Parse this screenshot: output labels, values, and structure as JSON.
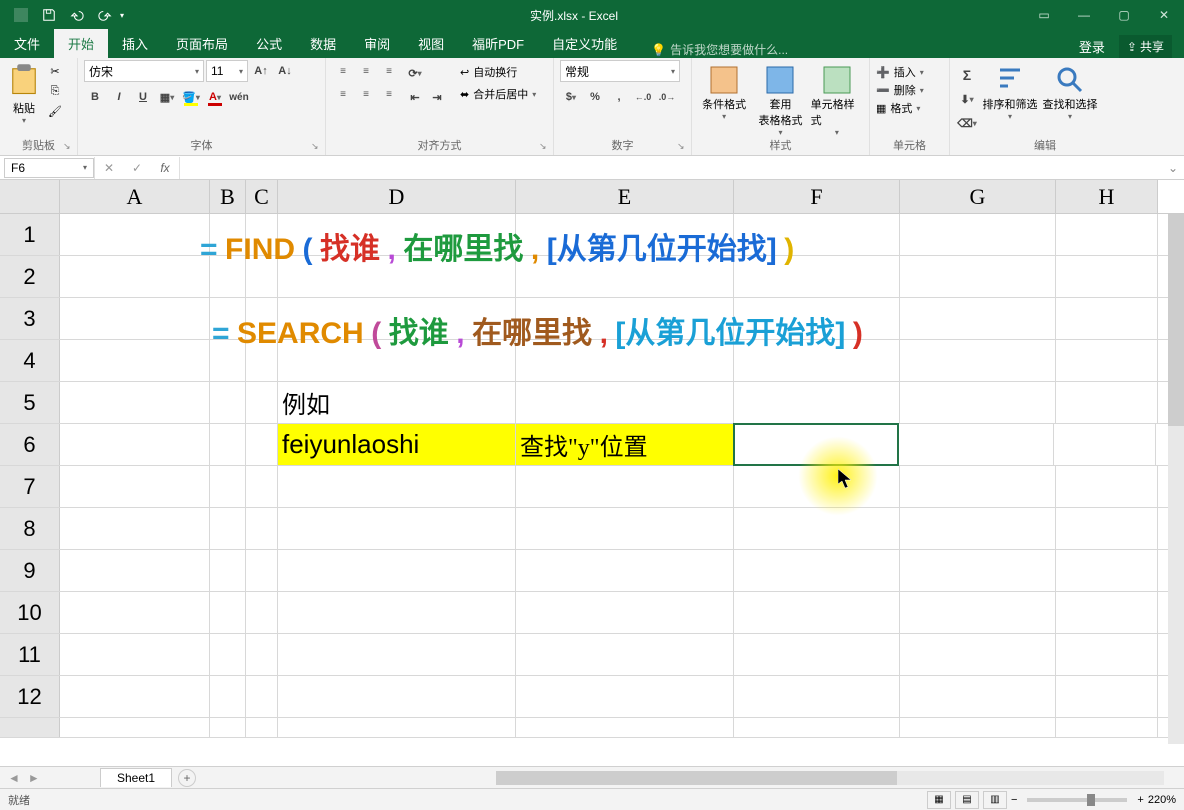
{
  "titlebar": {
    "filename": "实例.xlsx - Excel"
  },
  "tabs": {
    "items": [
      "文件",
      "开始",
      "插入",
      "页面布局",
      "公式",
      "数据",
      "审阅",
      "视图",
      "福昕PDF",
      "自定义功能"
    ],
    "active": 1,
    "tell_me": "告诉我您想要做什么...",
    "login": "登录",
    "share": "共享"
  },
  "ribbon": {
    "clipboard": {
      "label": "剪贴板",
      "paste": "粘贴"
    },
    "font": {
      "label": "字体",
      "name": "仿宋",
      "size": "11",
      "bold": "B",
      "italic": "I",
      "underline": "U",
      "ruby": "wén"
    },
    "align": {
      "label": "对齐方式",
      "wrap": "自动换行",
      "merge": "合并后居中"
    },
    "number": {
      "label": "数字",
      "format": "常规",
      "percent": "%",
      "comma": ",",
      "inc": ".00",
      "dec": ".0"
    },
    "styles": {
      "label": "样式",
      "cond": "条件格式",
      "table": "套用\n表格格式",
      "cell": "单元格样式"
    },
    "cells": {
      "label": "单元格",
      "insert": "插入",
      "delete": "删除",
      "format": "格式"
    },
    "editing": {
      "label": "编辑",
      "sum": "Σ",
      "sort": "排序和筛选",
      "find": "查找和选择"
    }
  },
  "formula_bar": {
    "name_box": "F6",
    "fx": "fx",
    "value": ""
  },
  "columns": [
    "A",
    "B",
    "C",
    "D",
    "E",
    "F",
    "G",
    "H"
  ],
  "rows": [
    "1",
    "2",
    "3",
    "4",
    "5",
    "6",
    "7",
    "8",
    "9",
    "10",
    "11",
    "12"
  ],
  "cells": {
    "D5": "例如",
    "D6": "feiyunlaoshi",
    "E6": "查找\"y\"位置"
  },
  "formula_overlay": {
    "line1": {
      "eq": "=",
      "fn": "FIND",
      "lp": "(",
      "a1": "找谁",
      "c1": ",",
      "a2": "在哪里找",
      "c2": ",",
      "a3": "[从第几位开始找]",
      "rp": ")"
    },
    "line2": {
      "eq": "=",
      "fn": "SEARCH",
      "lp": "(",
      "a1": "找谁",
      "c1": ",",
      "a2": "在哪里找",
      "c2": ",",
      "a3": "[从第几位开始找]",
      "rp": ")"
    }
  },
  "sheet_tabs": {
    "active": "Sheet1"
  },
  "status": {
    "ready": "就绪",
    "zoom": "220%"
  }
}
